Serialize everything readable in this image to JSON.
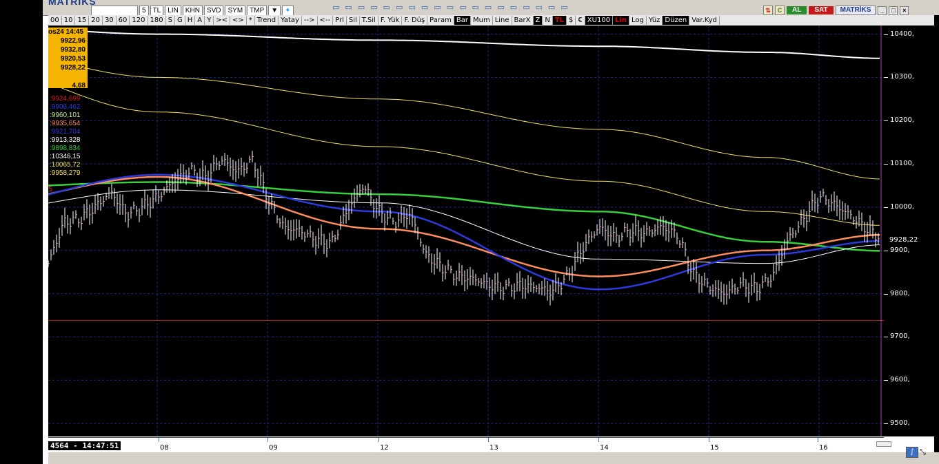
{
  "app": {
    "logo": "MATRİKS",
    "top_fields": [
      "5",
      "TL",
      "LIN",
      "KHN",
      "SVD",
      "SYM",
      "TMP"
    ],
    "al_label": "AL",
    "sat_label": "SAT",
    "logo_right": "MATRİKS"
  },
  "toolbar": {
    "items": [
      "10",
      "15",
      "20",
      "30",
      "60",
      "120",
      "180",
      "S",
      "G",
      "H",
      "A",
      "Y",
      "><",
      "<>",
      "*",
      "Trend",
      "Yatay",
      "-->",
      "<--",
      "Prl",
      "Sil",
      "T.Sil",
      "F. Yük",
      "F. Düş",
      "Param",
      "Bar",
      "Mum",
      "Line",
      "BarX",
      "Z",
      "N",
      "TL",
      "$",
      "€",
      "XU100",
      "Lin",
      "Log",
      "Yüz",
      "Düzen",
      "Var.Kyd"
    ],
    "selected": [
      "Bar",
      "Z",
      "TL",
      "XU100",
      "Lin",
      "Düzen"
    ],
    "red": [
      "TL",
      "Lin"
    ],
    "left_cut": "00"
  },
  "info_box": {
    "header": "os24 14:45",
    "values": [
      "9922,96",
      "9932,80",
      "9920,53",
      "9928,22"
    ],
    "change": "4,68"
  },
  "indicators": [
    {
      "value": ":9924,699",
      "color": "#d61a1a"
    },
    {
      "value": ":9908,462",
      "color": "#2b3be0"
    },
    {
      "value": ":9960,101",
      "color": "#c8f09a"
    },
    {
      "value": ":9935,654",
      "color": "#ff8c5a"
    },
    {
      "value": ":9921,704",
      "color": "#2b3be0"
    },
    {
      "value": ":9913,328",
      "color": "#ffffff"
    },
    {
      "value": ":9898,834",
      "color": "#35d03a"
    },
    {
      "value": ":10346,15",
      "color": "#ffffff"
    },
    {
      "value": ":10065,72",
      "color": "#f0e060"
    },
    {
      "value": ":9958,279",
      "color": "#f0e060"
    }
  ],
  "axis_marker": "5",
  "yaxis": {
    "labels": [
      "10400,",
      "10300,",
      "10200,",
      "10100,",
      "10000,",
      "9900,",
      "9800,",
      "9700,",
      "9600,",
      "9500,"
    ],
    "last_price": "9928,22"
  },
  "xaxis": {
    "labels": [
      "08",
      "09",
      "12",
      "13",
      "14",
      "15",
      "16"
    ],
    "time_badge": "4564 - 14:47:51"
  },
  "chart_data": {
    "type": "line",
    "title": "",
    "xlabel": "",
    "ylabel": "",
    "x": [
      "08",
      "09",
      "12",
      "13",
      "14",
      "15",
      "16"
    ],
    "ylim": [
      9470,
      10420
    ],
    "grid": true,
    "support_line": 9738,
    "last_price": 9928.22,
    "price_series": [
      9870,
      9965,
      9972,
      10001,
      10035,
      9982,
      10000,
      10025,
      10060,
      10085,
      10068,
      10111,
      10082,
      10108,
      10015,
      9952,
      9946,
      9925,
      9916,
      9993,
      10050,
      9990,
      9965,
      9985,
      9890,
      9862,
      9840,
      9835,
      9820,
      9812,
      9820,
      9815,
      9805,
      9840,
      9908,
      9955,
      9930,
      9945,
      9940,
      9956,
      9935,
      9845,
      9815,
      9800,
      9822,
      9810,
      9840,
      9925,
      9972,
      10025,
      10005,
      9980,
      9950,
      9928
    ],
    "series": [
      {
        "name": "",
        "color": "#ffffff",
        "values": [
          10420,
          10400,
          10386,
          10372,
          10358,
          10344
        ]
      },
      {
        "name": "",
        "color": "#f0e060",
        "values": [
          10370,
          10300,
          10250,
          10180,
          10115,
          10065
        ]
      },
      {
        "name": "",
        "color": "#f0e060",
        "values": [
          10330,
          10220,
          10140,
          10060,
          9990,
          9958
        ]
      },
      {
        "name": "",
        "color": "#35d03a",
        "values": [
          10045,
          10058,
          10030,
          9990,
          9920,
          9899
        ]
      },
      {
        "name": "",
        "color": "#ffffff",
        "values": [
          9990,
          10040,
          10010,
          9880,
          9870,
          9913
        ]
      },
      {
        "name": "",
        "color": "#ff8c5a",
        "values": [
          10005,
          10070,
          9950,
          9840,
          9900,
          9936
        ]
      },
      {
        "name": "",
        "color": "#2b3be0",
        "values": [
          10000,
          10075,
          9990,
          9810,
          9890,
          9922
        ]
      }
    ]
  }
}
